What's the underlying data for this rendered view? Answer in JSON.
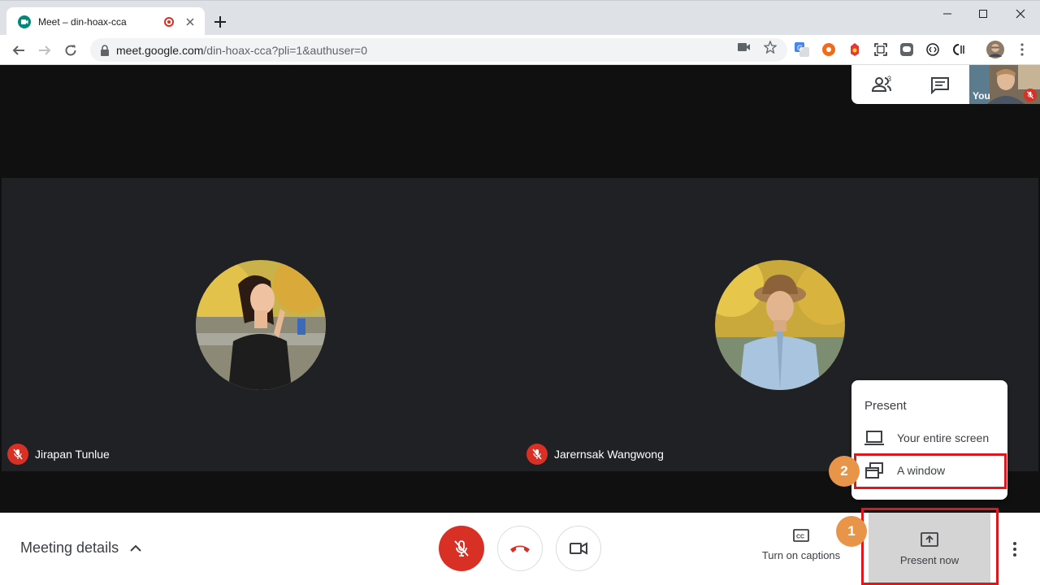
{
  "browser": {
    "tab_title": "Meet – din-hoax-cca",
    "url_host": "meet.google.com",
    "url_path": "/din-hoax-cca?pli=1&authuser=0"
  },
  "meet": {
    "participant_count": "3",
    "self_label": "You",
    "participants": [
      {
        "name": "Jirapan Tunlue"
      },
      {
        "name": "Jarernsak Wangwong"
      }
    ],
    "present_menu": {
      "title": "Present",
      "items": [
        {
          "label": "Your entire screen",
          "icon": "laptop-icon"
        },
        {
          "label": "A window",
          "icon": "window-icon"
        }
      ]
    },
    "bottom_bar": {
      "meeting_details": "Meeting details",
      "captions": "Turn on captions",
      "present_now": "Present now"
    },
    "steps": [
      "1",
      "2"
    ]
  },
  "colors": {
    "mute_red": "#d93025",
    "annotation_red": "#e0161c",
    "step_badge": "#e8954a",
    "stage_bg": "#202124"
  }
}
